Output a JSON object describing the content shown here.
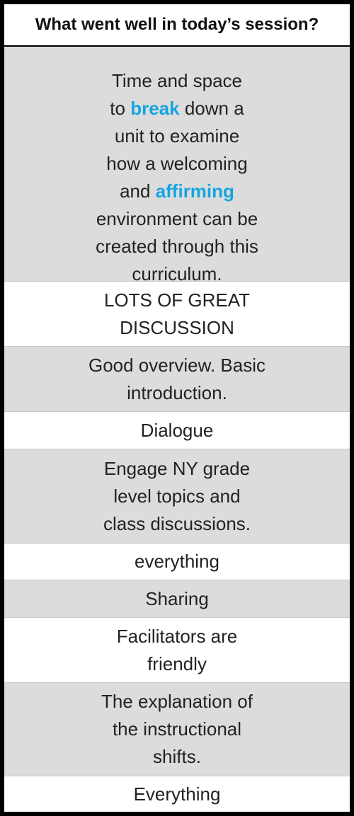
{
  "header": {
    "title": "What went well in today’s session?"
  },
  "colors": {
    "highlight": "#16a5e0",
    "row_gray": "#dcdcdc",
    "row_white": "#ffffff"
  },
  "responses": [
    {
      "parts": [
        {
          "text": "Time and space\nto "
        },
        {
          "text": "break",
          "highlight": true
        },
        {
          "text": " down a\nunit to examine\nhow a welcoming\nand "
        },
        {
          "text": "affirming",
          "highlight": true
        },
        {
          "text": "\nenvironment can be\ncreated through this\ncurriculum."
        }
      ]
    },
    {
      "parts": [
        {
          "text": "LOTS OF GREAT\nDISCUSSION"
        }
      ]
    },
    {
      "parts": [
        {
          "text": "Good overview. Basic\nintroduction."
        }
      ]
    },
    {
      "parts": [
        {
          "text": "Dialogue"
        }
      ]
    },
    {
      "parts": [
        {
          "text": "Engage NY grade\nlevel topics and\nclass discussions."
        }
      ]
    },
    {
      "parts": [
        {
          "text": "everything"
        }
      ]
    },
    {
      "parts": [
        {
          "text": "Sharing"
        }
      ]
    },
    {
      "parts": [
        {
          "text": "Facilitators are\nfriendly"
        }
      ]
    },
    {
      "parts": [
        {
          "text": "The explanation of\nthe instructional\nshifts."
        }
      ]
    },
    {
      "parts": [
        {
          "text": "Everything"
        }
      ]
    }
  ]
}
